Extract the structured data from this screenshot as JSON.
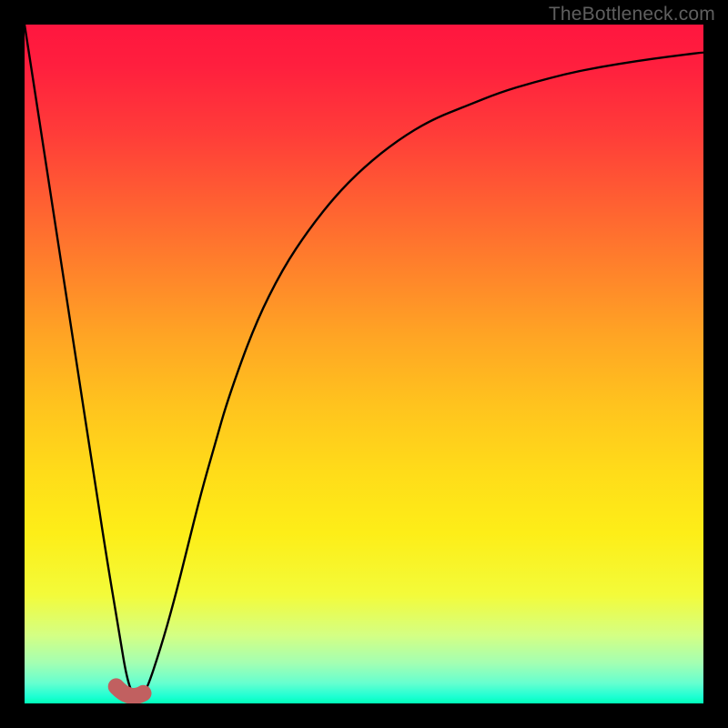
{
  "watermark": "TheBottleneck.com",
  "chart_data": {
    "type": "line",
    "title": "",
    "xlabel": "",
    "ylabel": "",
    "xlim": [
      0,
      100
    ],
    "ylim": [
      0,
      100
    ],
    "grid": false,
    "legend": false,
    "series": [
      {
        "name": "bottleneck-curve",
        "x": [
          0,
          2,
          4,
          6,
          8,
          10,
          12,
          14,
          15,
          16,
          17,
          18,
          20,
          22,
          24,
          26,
          28,
          30,
          34,
          38,
          42,
          46,
          50,
          55,
          60,
          65,
          70,
          75,
          80,
          85,
          90,
          95,
          100
        ],
        "values": [
          100,
          87,
          74,
          61,
          48,
          35,
          22,
          10,
          4,
          1,
          1,
          2,
          8,
          15,
          23,
          31,
          38,
          45,
          56,
          64,
          70,
          75,
          79,
          83,
          86,
          88,
          90,
          91.5,
          92.8,
          93.8,
          94.6,
          95.3,
          95.9
        ]
      }
    ],
    "marker": {
      "name": "highlight-segment",
      "x": [
        13.5,
        17.5
      ],
      "y": [
        2.5,
        1.5
      ]
    },
    "background_gradient": {
      "orientation": "vertical",
      "stops": [
        {
          "pos": 0,
          "color": "#ff163f"
        },
        {
          "pos": 50,
          "color": "#ffc31e"
        },
        {
          "pos": 85,
          "color": "#f3fb3a"
        },
        {
          "pos": 100,
          "color": "#00ffb8"
        }
      ]
    }
  }
}
